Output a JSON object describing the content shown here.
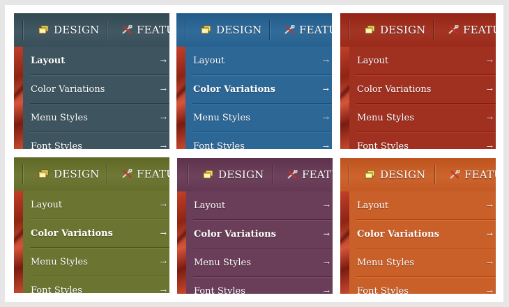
{
  "menu": {
    "tabs": [
      {
        "label": "DESIGN",
        "icon": "window-icon"
      },
      {
        "label": "FEATU",
        "icon": "tools-icon"
      }
    ],
    "items": [
      {
        "label": "Layout",
        "arrow": "→"
      },
      {
        "label": "Color Variations",
        "arrow": "→"
      },
      {
        "label": "Menu Styles",
        "arrow": "→"
      },
      {
        "label": "Font Styles",
        "arrow": "→"
      }
    ]
  },
  "variants": [
    {
      "name": "slate",
      "color": "#3e5560",
      "highlight_item": 0
    },
    {
      "name": "blue",
      "color": "#2d6796",
      "highlight_item": 1
    },
    {
      "name": "red",
      "color": "#a03020",
      "highlight_item": -1
    },
    {
      "name": "olive",
      "color": "#6b7430",
      "highlight_item": 1
    },
    {
      "name": "plum",
      "color": "#6a3e58",
      "highlight_item": 1
    },
    {
      "name": "orange",
      "color": "#c9602a",
      "highlight_item": 1
    }
  ]
}
